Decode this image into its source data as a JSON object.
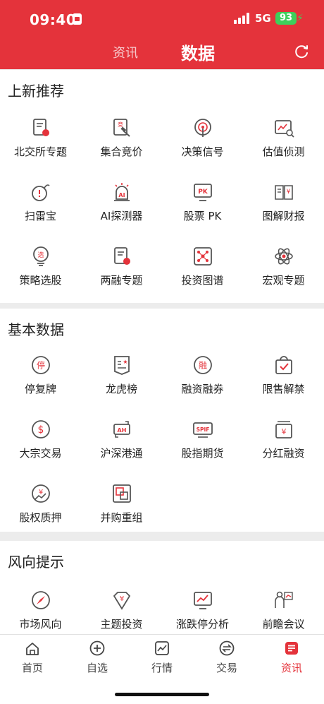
{
  "status_bar": {
    "time": "09:40",
    "network": "5G",
    "battery": "93"
  },
  "header": {
    "tab_news": "资讯",
    "tab_data": "数据"
  },
  "colors": {
    "accent": "#e4333b",
    "icon_stroke": "#555555"
  },
  "sections": [
    {
      "title": "上新推荐",
      "items": [
        {
          "label": "北交所专题",
          "icon": "document-badge-icon"
        },
        {
          "label": "集合竞价",
          "icon": "auction-hammer-icon"
        },
        {
          "label": "决策信号",
          "icon": "signal-broadcast-icon"
        },
        {
          "label": "估值侦测",
          "icon": "chart-magnifier-icon"
        },
        {
          "label": "扫雷宝",
          "icon": "bomb-icon"
        },
        {
          "label": "AI探测器",
          "icon": "ai-alarm-icon"
        },
        {
          "label": "股票 PK",
          "icon": "pk-monitor-icon"
        },
        {
          "label": "图解财报",
          "icon": "book-report-icon"
        },
        {
          "label": "策略选股",
          "icon": "stock-picker-icon"
        },
        {
          "label": "两融专题",
          "icon": "margin-document-icon"
        },
        {
          "label": "投资图谱",
          "icon": "network-graph-icon"
        },
        {
          "label": "宏观专题",
          "icon": "atom-icon"
        }
      ]
    },
    {
      "title": "基本数据",
      "items": [
        {
          "label": "停复牌",
          "icon": "suspend-circle-icon"
        },
        {
          "label": "龙虎榜",
          "icon": "ranking-banner-icon"
        },
        {
          "label": "融资融券",
          "icon": "margin-circle-icon"
        },
        {
          "label": "限售解禁",
          "icon": "shopping-bag-check-icon"
        },
        {
          "label": "大宗交易",
          "icon": "dollar-circle-icon"
        },
        {
          "label": "沪深港通",
          "icon": "ah-exchange-icon"
        },
        {
          "label": "股指期货",
          "icon": "spif-card-icon"
        },
        {
          "label": "分红融资",
          "icon": "yuan-wallet-icon"
        },
        {
          "label": "股权质押",
          "icon": "yuan-trend-circle-icon"
        },
        {
          "label": "并购重组",
          "icon": "merge-squares-icon"
        }
      ]
    },
    {
      "title": "风向提示",
      "items": [
        {
          "label": "市场风向",
          "icon": "compass-icon"
        },
        {
          "label": "主题投资",
          "icon": "yuan-diamond-icon"
        },
        {
          "label": "涨跌停分析",
          "icon": "trend-board-icon"
        },
        {
          "label": "前瞻会议",
          "icon": "presenter-icon"
        }
      ]
    }
  ],
  "tabbar": [
    {
      "label": "首页",
      "icon": "home-icon",
      "active": false
    },
    {
      "label": "自选",
      "icon": "plus-circle-icon",
      "active": false
    },
    {
      "label": "行情",
      "icon": "chart-line-icon",
      "active": false
    },
    {
      "label": "交易",
      "icon": "exchange-icon",
      "active": false
    },
    {
      "label": "资讯",
      "icon": "news-icon",
      "active": true
    }
  ]
}
